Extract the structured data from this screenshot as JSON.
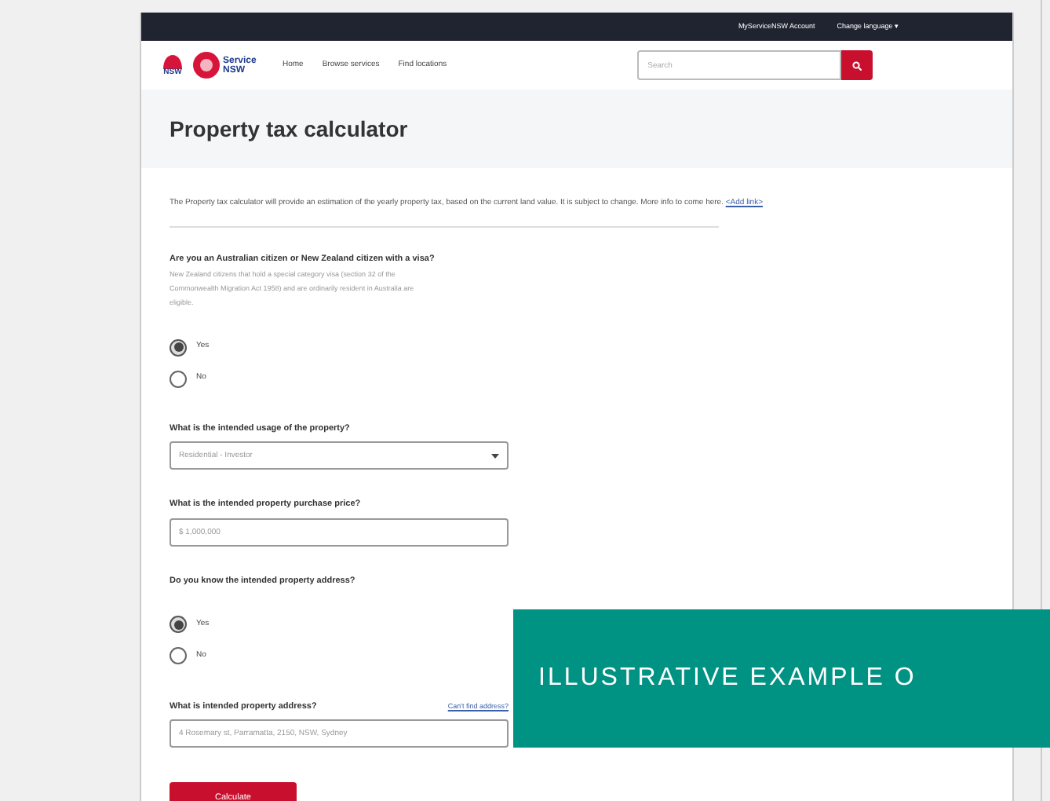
{
  "top_bar": {
    "links": [
      "MyServiceNSW Account",
      "Change language ▾"
    ]
  },
  "header": {
    "logos": [
      "NSW",
      "Service NSW"
    ],
    "nav": [
      "Home",
      "Browse services",
      "Find locations"
    ],
    "search": {
      "placeholder": "Search"
    }
  },
  "page_title": "Property tax calculator",
  "intro": {
    "text": "The Property tax calculator will provide an estimation of the yearly property tax, based on the current land value. It is subject to change. More info to come here.",
    "link": "<Add link>"
  },
  "form": [
    {
      "kind": "radio",
      "label": "Are you an Australian citizen or New Zealand citizen with a visa?",
      "hint": "New Zealand citizens that hold a special category visa (section 32 of the Commonwealth Migration Act 1958) and are ordinarily resident in Australia are eligible.",
      "options": [
        {
          "label": "Yes",
          "selected": true
        },
        {
          "label": "No",
          "selected": false
        }
      ]
    },
    {
      "kind": "select",
      "label": "What is the intended usage of the property?",
      "value": "Residential - Investor"
    },
    {
      "kind": "input",
      "label": "What is the intended property purchase price?",
      "value": "$ 1,000,000"
    },
    {
      "kind": "radio",
      "label": "Do you know the intended property address?",
      "options": [
        {
          "label": "Yes",
          "selected": true
        },
        {
          "label": "No",
          "selected": false
        }
      ]
    },
    {
      "kind": "input",
      "label": "What is intended property address?",
      "link": "Can't find address?",
      "value": "4 Rosemary st, Parramatta, 2150, NSW, Sydney"
    }
  ],
  "submit": "Calculate",
  "banner": "ILLUSTRATIVE EXAMPLE O"
}
